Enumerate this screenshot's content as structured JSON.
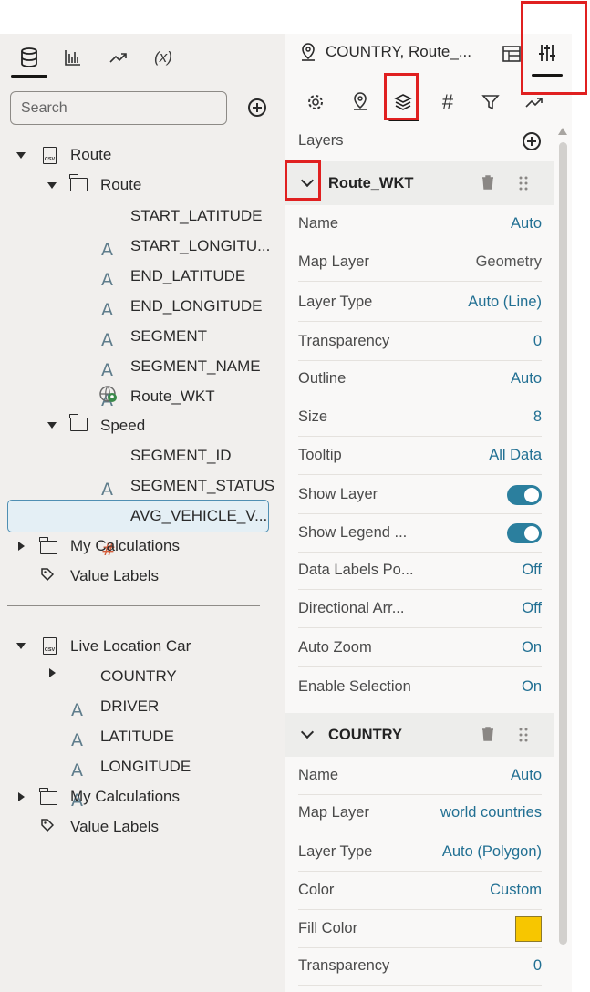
{
  "left_tabs": [
    {
      "name": "data-icon",
      "glyph": "database"
    },
    {
      "name": "visualizations-icon",
      "glyph": "bar"
    },
    {
      "name": "analytics-icon",
      "glyph": "trend"
    },
    {
      "name": "calculation-icon",
      "glyph": "(x)"
    }
  ],
  "search": {
    "placeholder": "Search"
  },
  "tree": {
    "route_ds": "Route",
    "route_folder": "Route",
    "route_fields": [
      "START_LATITUDE",
      "START_LONGITU...",
      "END_LATITUDE",
      "END_LONGITUDE",
      "SEGMENT",
      "SEGMENT_NAME",
      "Route_WKT"
    ],
    "speed_folder": "Speed",
    "speed_fields": [
      "SEGMENT_ID",
      "SEGMENT_STATUS",
      "AVG_VEHICLE_V..."
    ],
    "my_calc_1": "My Calculations",
    "value_labels_1": "Value Labels",
    "live_ds": "Live Location Car",
    "live_fields": [
      "COUNTRY",
      "DRIVER",
      "LATITUDE",
      "LONGITUDE"
    ],
    "my_calc_2": "My Calculations",
    "value_labels_2": "Value Labels"
  },
  "right": {
    "title": "COUNTRY, Route_...",
    "layers_label": "Layers",
    "layer1": {
      "name": "Route_WKT",
      "props": [
        {
          "label": "Name",
          "value": "Auto"
        },
        {
          "label": "Map Layer",
          "value": "Geometry"
        },
        {
          "label": "Layer Type",
          "value": "Auto (Line)"
        },
        {
          "label": "Transparency",
          "value": "0"
        },
        {
          "label": "Outline",
          "value": "Auto"
        },
        {
          "label": "Size",
          "value": "8"
        },
        {
          "label": "Tooltip",
          "value": "All Data"
        },
        {
          "label": "Show Layer",
          "value": ""
        },
        {
          "label": "Show Legend ...",
          "value": ""
        },
        {
          "label": "Data Labels Po...",
          "value": "Off"
        },
        {
          "label": "Directional Arr...",
          "value": "Off"
        },
        {
          "label": "Auto Zoom",
          "value": "On"
        },
        {
          "label": "Enable Selection",
          "value": "On"
        }
      ]
    },
    "layer2": {
      "name": "COUNTRY",
      "props": [
        {
          "label": "Name",
          "value": "Auto"
        },
        {
          "label": "Map Layer",
          "value": "world countries"
        },
        {
          "label": "Layer Type",
          "value": "Auto (Polygon)"
        },
        {
          "label": "Color",
          "value": "Custom"
        },
        {
          "label": "Fill Color",
          "value": ""
        },
        {
          "label": "Transparency",
          "value": "0"
        }
      ],
      "fill_color": "#f7c600"
    }
  },
  "colors": {
    "accent": "#227093",
    "highlight": "#e02020",
    "toggle_on": "#2b7f9e",
    "hash_icon": "#d55d3a"
  }
}
